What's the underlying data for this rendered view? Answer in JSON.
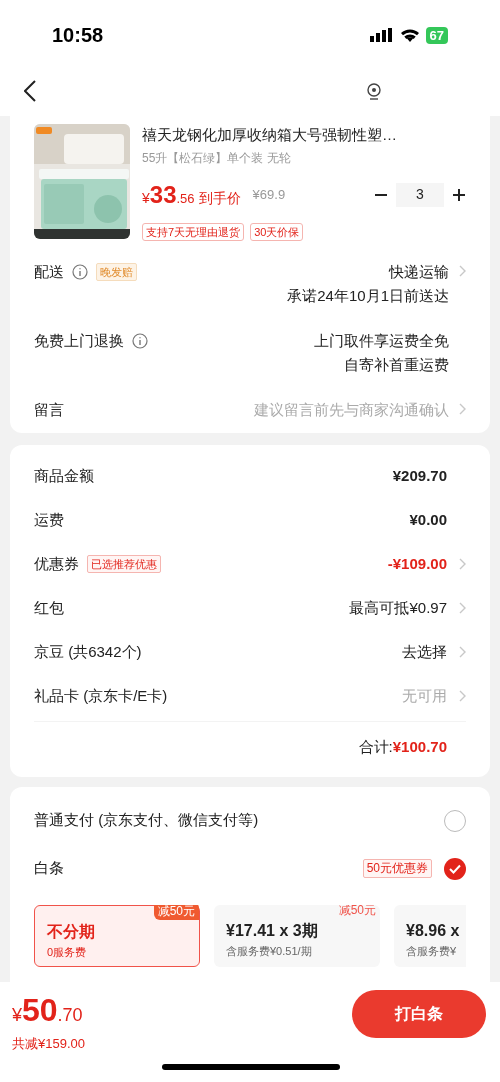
{
  "status_bar": {
    "time": "10:58",
    "battery": "67"
  },
  "product": {
    "title": "禧天龙钢化加厚收纳箱大号强韧性塑…",
    "spec": "55升【松石绿】单个装 无轮",
    "price": {
      "currency": "¥",
      "integer": "33",
      "decimal": ".56",
      "label": "到手价"
    },
    "original_price": "¥69.9",
    "quantity": "3",
    "tags": [
      "支持7天无理由退货",
      "30天价保"
    ]
  },
  "service_rows": [
    {
      "label": "配送",
      "info": true,
      "badge": "晚发赔",
      "values": [
        "快递运输",
        "承诺24年10月1日前送达"
      ],
      "kind": "normal",
      "chevron": true
    },
    {
      "label": "免费上门退换",
      "info": true,
      "values": [
        "上门取件享运费全免",
        "自寄补首重运费"
      ],
      "kind": "normal",
      "chevron": false
    },
    {
      "label": "留言",
      "info": false,
      "values": [
        "建议留言前先与商家沟通确认"
      ],
      "kind": "muted",
      "chevron": true
    }
  ],
  "summary_rows": [
    {
      "label": "商品金额",
      "value": "¥209.70",
      "kind": "bold",
      "chevron": false
    },
    {
      "label": "运费",
      "value": "¥0.00",
      "kind": "bold",
      "chevron": false
    },
    {
      "label": "优惠券",
      "badge": "已选推荐优惠",
      "value": "-¥109.00",
      "kind": "red",
      "chevron": true
    },
    {
      "label": "红包",
      "value": "最高可抵¥0.97",
      "kind": "normal",
      "chevron": true
    },
    {
      "label": "京豆 (共6342个)",
      "value": "去选择",
      "kind": "normal",
      "chevron": true
    },
    {
      "label": "礼品卡 (京东卡/E卡)",
      "value": "无可用",
      "kind": "muted",
      "chevron": true
    }
  ],
  "total": {
    "label": "合计:",
    "value": "¥100.70"
  },
  "payment_options": [
    {
      "label": "普通支付 (京东支付、微信支付等)",
      "selected": false
    },
    {
      "label": "白条",
      "coupon": "50元优惠券",
      "selected": true
    }
  ],
  "plans": [
    {
      "badge": "减50元",
      "title": "不分期",
      "subtitle": "0服务费",
      "selected": true
    },
    {
      "badge": "减50元",
      "title": "¥17.41 x 3期",
      "subtitle": "含服务费¥0.51/期",
      "selected": false
    },
    {
      "title": "¥8.96 x",
      "subtitle": "含服务费¥",
      "selected": false
    }
  ],
  "footer": {
    "price": {
      "currency": "¥",
      "integer": "50",
      "decimal": ".70"
    },
    "saving": "共减¥159.00",
    "button": "打白条"
  }
}
